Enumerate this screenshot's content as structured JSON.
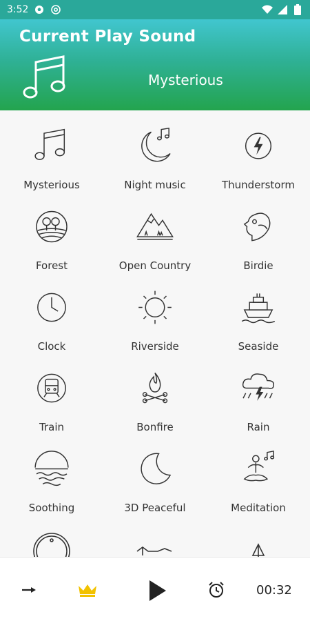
{
  "status_bar": {
    "time": "3:52",
    "icons": [
      "soccer-ball-icon",
      "at-sign-icon",
      "wifi-icon",
      "signal-icon",
      "battery-icon"
    ]
  },
  "header": {
    "title": "Current Play Sound",
    "current_sound": "Mysterious",
    "icon": "music-note-icon"
  },
  "sounds": [
    {
      "label": "Mysterious",
      "icon": "music-note-icon"
    },
    {
      "label": "Night music",
      "icon": "moon-note-icon"
    },
    {
      "label": "Thunderstorm",
      "icon": "lightning-icon"
    },
    {
      "label": "Forest",
      "icon": "forest-icon"
    },
    {
      "label": "Open Country",
      "icon": "mountain-icon"
    },
    {
      "label": "Birdie",
      "icon": "bird-icon"
    },
    {
      "label": "Clock",
      "icon": "clock-icon"
    },
    {
      "label": "Riverside",
      "icon": "sun-icon"
    },
    {
      "label": "Seaside",
      "icon": "ship-icon"
    },
    {
      "label": "Train",
      "icon": "train-icon"
    },
    {
      "label": "Bonfire",
      "icon": "bonfire-icon"
    },
    {
      "label": "Rain",
      "icon": "rain-cloud-icon"
    },
    {
      "label": "Soothing",
      "icon": "sunset-waves-icon"
    },
    {
      "label": "3D Peaceful",
      "icon": "crescent-moon-icon"
    },
    {
      "label": "Meditation",
      "icon": "meditation-icon"
    }
  ],
  "player": {
    "time": "00:32",
    "buttons": [
      "arrow-right-icon",
      "crown-icon",
      "play-icon",
      "alarm-clock-icon"
    ],
    "crown_color": "#f2c200"
  },
  "colors": {
    "header_top": "#41c6cf",
    "header_bottom": "#23a44e",
    "status_bar": "#2aa89a"
  }
}
